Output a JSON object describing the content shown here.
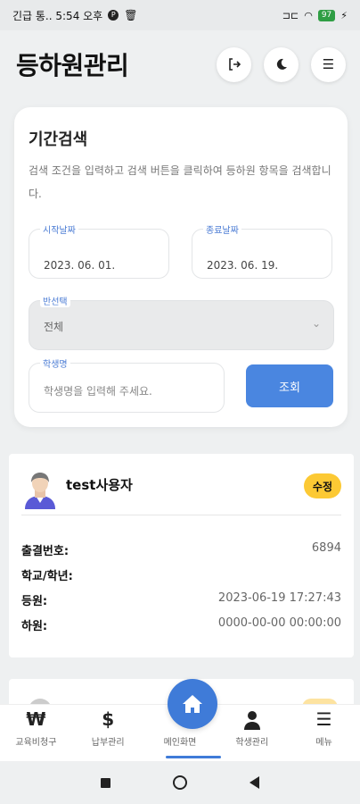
{
  "status_bar": {
    "left_text": "긴급 통.. 5:54 오후",
    "battery": "97"
  },
  "header": {
    "title": "등하원관리",
    "logout_icon": "logout-icon",
    "dark_mode_icon": "moon-icon",
    "menu_icon": "hamburger-icon"
  },
  "search": {
    "title": "기간검색",
    "description": "검색 조건을 입력하고 검색 버튼을 클릭하여 등하원 항목을 검색합니다.",
    "start_date_label": "시작날짜",
    "start_date_value": "2023. 06. 01.",
    "end_date_label": "종료날짜",
    "end_date_value": "2023. 06. 19.",
    "class_label": "반선택",
    "class_value": "전체",
    "student_label": "학생명",
    "student_placeholder": "학생명을 입력해 주세요.",
    "query_button": "조회"
  },
  "record": {
    "user_name": "test사용자",
    "edit_badge": "수정",
    "rows": [
      {
        "key": "출결번호:",
        "value": "6894"
      },
      {
        "key": "학교/학년:",
        "value": ""
      },
      {
        "key": "등원:",
        "value": "2023-06-19 17:27:43"
      },
      {
        "key": "하원:",
        "value": "0000-00-00 00:00:00"
      }
    ]
  },
  "bottom_nav": {
    "items": [
      {
        "icon": "won-icon",
        "glyph": "₩",
        "label": "교육비청구"
      },
      {
        "icon": "dollar-icon",
        "glyph": "$",
        "label": "납부관리"
      },
      {
        "icon": "home-icon",
        "glyph": "",
        "label": "메인화면"
      },
      {
        "icon": "person-icon",
        "glyph": "",
        "label": "학생관리"
      },
      {
        "icon": "menu-icon",
        "glyph": "☰",
        "label": "메뉴"
      }
    ]
  },
  "colors": {
    "accent": "#3f7bd8",
    "badge": "#fcc934",
    "background": "#eef0f1"
  }
}
